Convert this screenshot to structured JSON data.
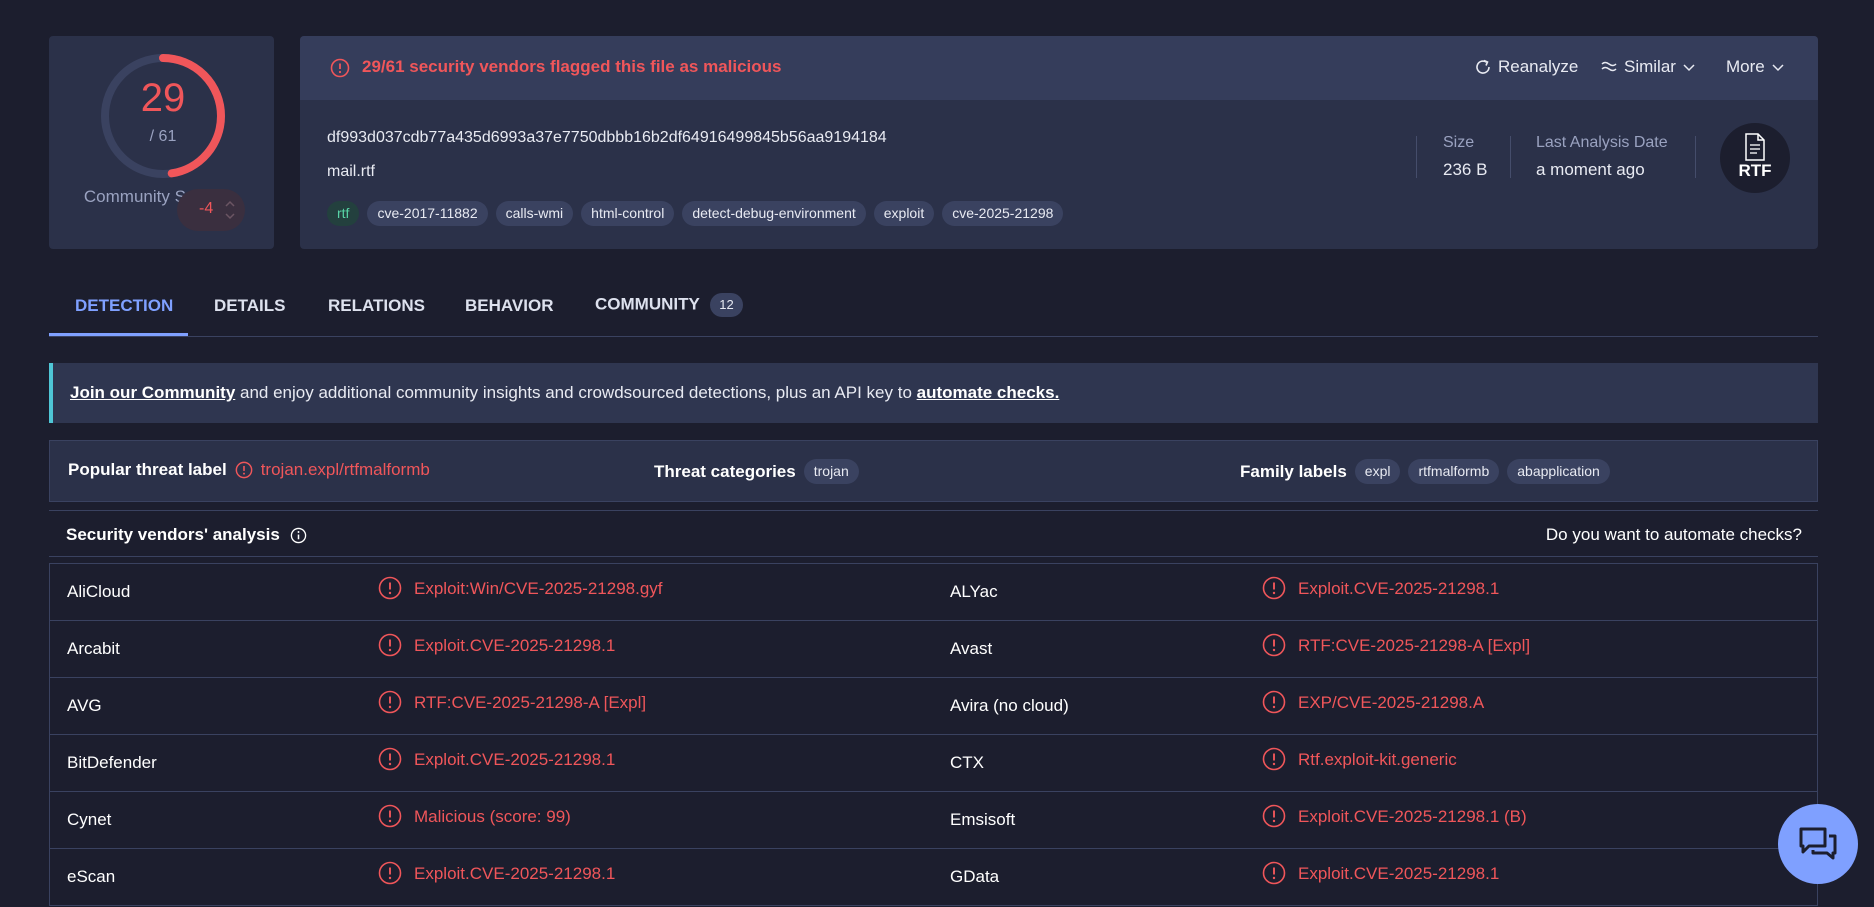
{
  "score": {
    "detected": "29",
    "total": "/ 61",
    "detected_fraction": 0.4754,
    "community_label": "Community Score",
    "community_value": "-4"
  },
  "alert": {
    "text": "29/61 security vendors flagged this file as malicious"
  },
  "actions": {
    "reanalyze": "Reanalyze",
    "similar": "Similar",
    "more": "More"
  },
  "file": {
    "hash": "df993d037cdb77a435d6993a37e7750dbbb16b2df64916499845b56aa9194184",
    "name": "mail.rtf",
    "tags": [
      "rtf",
      "cve-2017-11882",
      "calls-wmi",
      "html-control",
      "detect-debug-environment",
      "exploit",
      "cve-2025-21298"
    ],
    "size_label": "Size",
    "size_value": "236 B",
    "date_label": "Last Analysis Date",
    "date_value": "a moment ago",
    "type_badge": "RTF"
  },
  "tabs": [
    {
      "label": "DETECTION",
      "active": true
    },
    {
      "label": "DETAILS"
    },
    {
      "label": "RELATIONS"
    },
    {
      "label": "BEHAVIOR"
    },
    {
      "label": "COMMUNITY",
      "badge": "12"
    }
  ],
  "banner": {
    "link1": "Join our Community",
    "middle": " and enjoy additional community insights and crowdsourced detections, plus an API key to ",
    "link2": "automate checks."
  },
  "threat": {
    "popular_label": "Popular threat label",
    "popular_value": "trojan.expl/rtfmalformb",
    "categories_label": "Threat categories",
    "categories": [
      "trojan"
    ],
    "family_label": "Family labels",
    "families": [
      "expl",
      "rtfmalformb",
      "abapplication"
    ]
  },
  "vendors": {
    "title": "Security vendors' analysis",
    "automate": "Do you want to automate checks?",
    "rows": [
      [
        {
          "name": "AliCloud",
          "result": "Exploit:Win/CVE-2025-21298.gyf"
        },
        {
          "name": "ALYac",
          "result": "Exploit.CVE-2025-21298.1"
        }
      ],
      [
        {
          "name": "Arcabit",
          "result": "Exploit.CVE-2025-21298.1"
        },
        {
          "name": "Avast",
          "result": "RTF:CVE-2025-21298-A [Expl]"
        }
      ],
      [
        {
          "name": "AVG",
          "result": "RTF:CVE-2025-21298-A [Expl]"
        },
        {
          "name": "Avira (no cloud)",
          "result": "EXP/CVE-2025-21298.A"
        }
      ],
      [
        {
          "name": "BitDefender",
          "result": "Exploit.CVE-2025-21298.1"
        },
        {
          "name": "CTX",
          "result": "Rtf.exploit-kit.generic"
        }
      ],
      [
        {
          "name": "Cynet",
          "result": "Malicious (score: 99)"
        },
        {
          "name": "Emsisoft",
          "result": "Exploit.CVE-2025-21298.1 (B)"
        }
      ],
      [
        {
          "name": "eScan",
          "result": "Exploit.CVE-2025-21298.1"
        },
        {
          "name": "GData",
          "result": "Exploit.CVE-2025-21298.1"
        }
      ]
    ]
  },
  "colors": {
    "malicious": "#f0565a",
    "accent": "#7fa0ff",
    "background": "#1c1e2e",
    "card": "#2b3149"
  },
  "icons": [
    "alert-circle-icon",
    "refresh-icon",
    "similar-icon",
    "chevron-down-icon",
    "info-icon",
    "file-icon",
    "chat-icon"
  ]
}
